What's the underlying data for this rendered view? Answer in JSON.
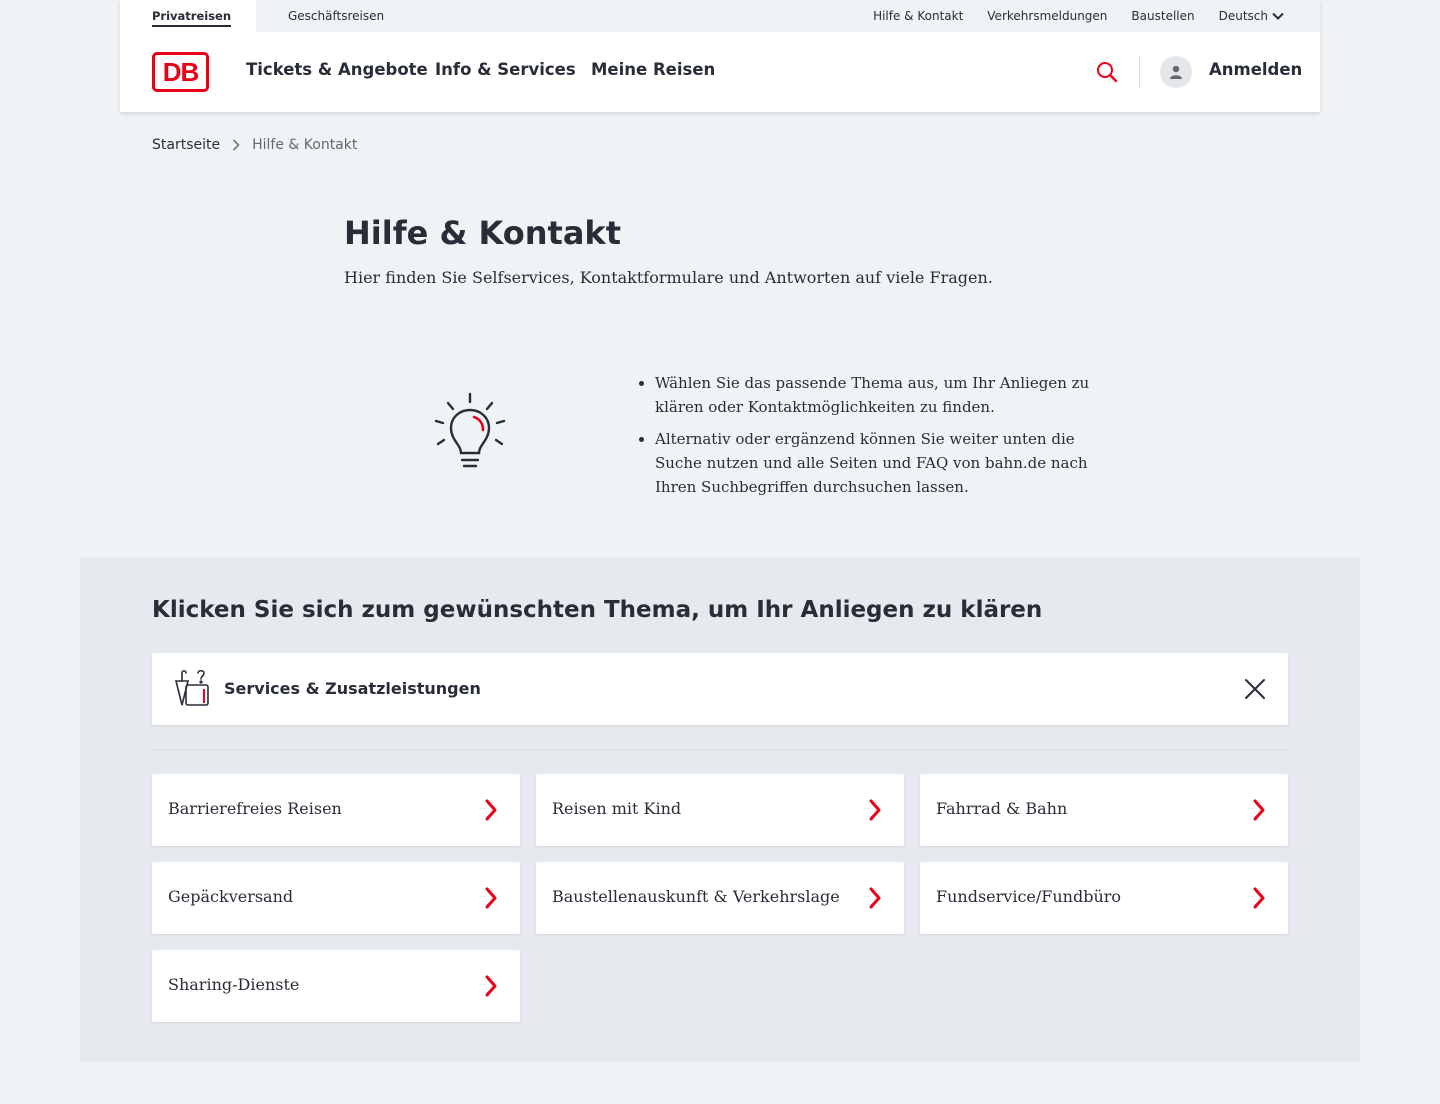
{
  "meta": {
    "tabs": [
      "Privatreisen",
      "Geschäftsreisen"
    ],
    "links": [
      "Hilfe & Kontakt",
      "Verkehrsmeldungen",
      "Baustellen"
    ],
    "language": "Deutsch"
  },
  "nav": {
    "logo": "DB",
    "items": [
      "Tickets & Angebote",
      "Info & Services",
      "Meine Reisen"
    ],
    "login": "Anmelden"
  },
  "breadcrumb": [
    "Startseite",
    "Hilfe & Kontakt"
  ],
  "intro": {
    "title": "Hilfe & Kontakt",
    "subtitle": "Hier finden Sie Selfservices, Kontaktformulare und Antworten auf viele Fragen.",
    "tips": [
      "Wählen Sie das passende Thema aus, um Ihr Anliegen zu klären oder Kontaktmöglichkeiten zu finden.",
      "Alternativ oder ergänzend können Sie weiter unten die Suche nutzen und alle Seiten und FAQ von bahn.de nach Ihren Suchbegriffen durchsuchen lassen."
    ]
  },
  "topics": {
    "heading": "Klicken Sie sich zum gewünschten Thema, um Ihr Anliegen zu klären",
    "open_category": "Services & Zusatzleistungen",
    "items": [
      "Barrierefreies Reisen",
      "Reisen mit Kind",
      "Fahrrad & Bahn",
      "Gepäckversand",
      "Baustellenauskunft & Verkehrslage",
      "Fundservice/Fundbüro",
      "Sharing-Dienste"
    ]
  },
  "colors": {
    "brand_red": "#ec0016",
    "text": "#282d37",
    "page_bg": "#f0f3f5",
    "section_bg": "#e6e9ed"
  }
}
